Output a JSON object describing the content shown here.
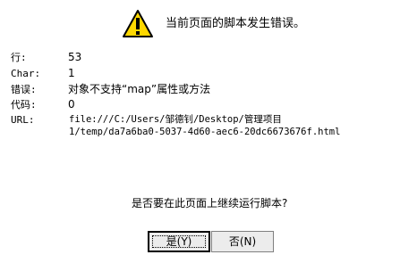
{
  "dialog": {
    "icon": "warning-icon",
    "headline": "当前页面的脚本发生错误。",
    "details": {
      "line_label": "行:",
      "line_value": "53",
      "char_label": "Char:",
      "char_value": "1",
      "error_label": "错误:",
      "error_value": "对象不支持“map”属性或方法",
      "code_label": "代码:",
      "code_value": "0",
      "url_label": "URL:",
      "url_line1": "file:///C:/Users/邹德钊/Desktop/管理项目",
      "url_line2": "1/temp/da7a6ba0-5037-4d60-aec6-20dc6673676f.html"
    },
    "question": "是否要在此页面上继续运行脚本?",
    "buttons": {
      "yes": "是(Y)",
      "no": "否(N)"
    }
  },
  "colors": {
    "warning_fill": "#ffd800",
    "warning_stroke": "#000000",
    "button_face": "#ececec"
  }
}
